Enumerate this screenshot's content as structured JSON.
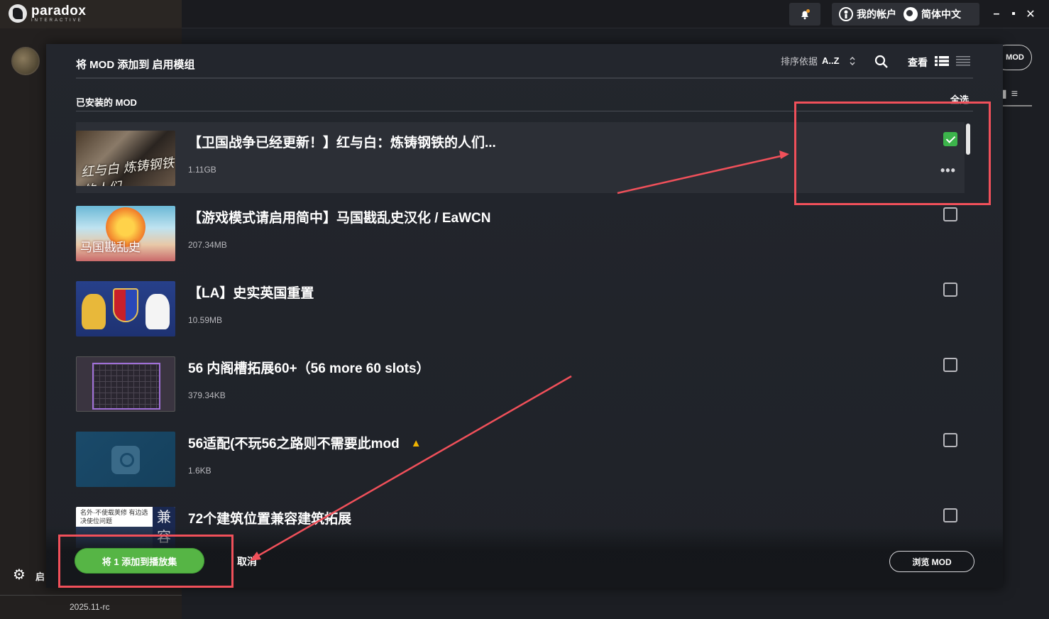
{
  "app": {
    "logo_word": "paradox",
    "logo_sub": "INTERACTIVE",
    "account_label": "我的帐户",
    "language_label": "简体中文",
    "version": "2025.11-rc",
    "launch_label_partial": "启",
    "behind_mod_pill": "MOD"
  },
  "modal": {
    "title": "将 MOD 添加到 启用模组",
    "sort_label": "排序依据",
    "sort_value": "A..Z",
    "view_label": "查看",
    "section_label": "已安装的 MOD",
    "select_all": "全选",
    "add_button": "将 1 添加到播放集",
    "cancel": "取消",
    "browse_button": "浏览 MOD"
  },
  "mods": [
    {
      "title": "【卫国战争已经更新！】红与白：炼铸钢铁的人们...",
      "size": "1.11GB",
      "checked": true,
      "thumb_text": "红与白 炼铸钢铁的人们",
      "warning": false
    },
    {
      "title": "【游戏模式请启用简中】马国戡乱史汉化 / EaWCN",
      "size": "207.34MB",
      "checked": false,
      "thumb_text": "马国戡乱史",
      "warning": false
    },
    {
      "title": "【LA】史实英国重置",
      "size": "10.59MB",
      "checked": false,
      "thumb_text": "",
      "warning": false
    },
    {
      "title": "56 内阁槽拓展60+（56 more 60 slots）",
      "size": "379.34KB",
      "checked": false,
      "thumb_text": "",
      "warning": false
    },
    {
      "title": "56适配(不玩56之路则不需要此mod",
      "size": "1.6KB",
      "checked": false,
      "thumb_text": "",
      "warning": true
    },
    {
      "title": "72个建筑位置兼容建筑拓展",
      "size": "",
      "checked": false,
      "thumb_text": "名外·不使载荚修 有边选决使位问题",
      "thumb_side": "兼容",
      "warning": false
    }
  ],
  "colors": {
    "accent_green": "#56b545",
    "check_green": "#3cb44b",
    "annotation_red": "#f0505a",
    "warning_yellow": "#f0b400"
  },
  "icons": [
    "notification-bell-icon",
    "account-icon",
    "globe-icon",
    "minimize-icon",
    "maximize-icon",
    "close-icon",
    "sort-arrows-icon",
    "search-icon",
    "list-view-icon",
    "compact-view-icon",
    "more-options-icon",
    "warning-icon",
    "gear-icon"
  ]
}
